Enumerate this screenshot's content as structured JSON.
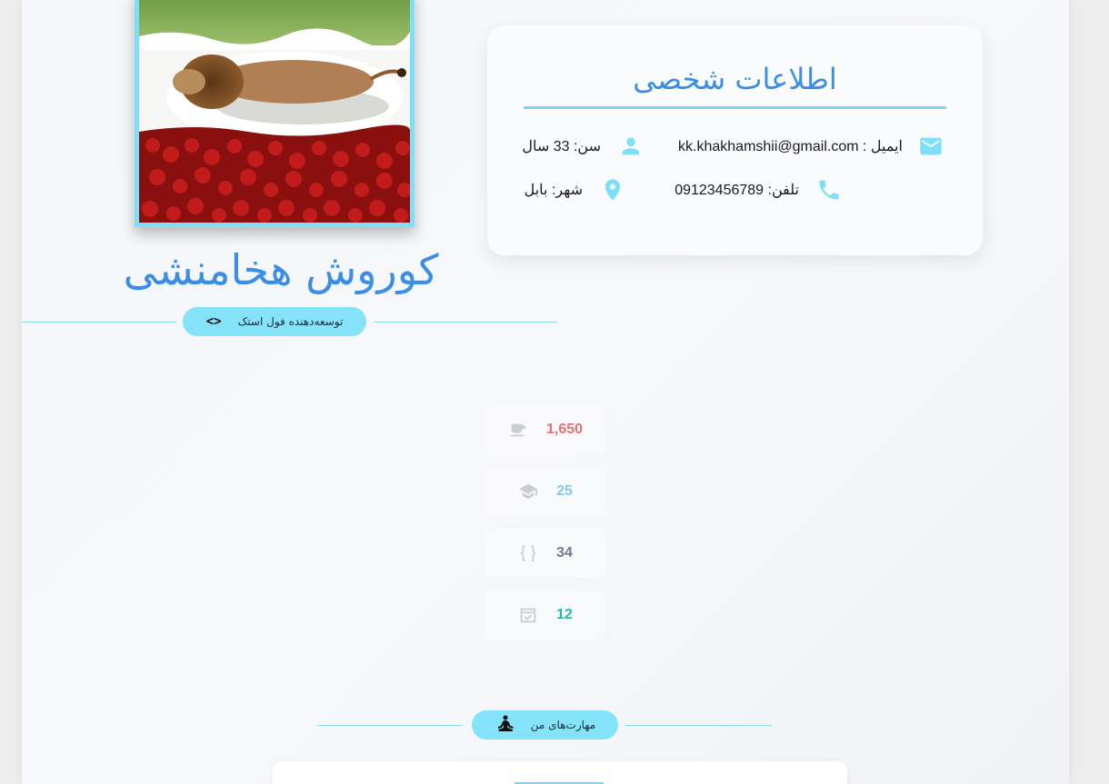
{
  "profile": {
    "name": "کوروش هخامنشی",
    "role": "توسعه‌دهنده فول استک",
    "role_icon": "code-icon"
  },
  "info_card": {
    "title": "اطلاعات شخصی",
    "items": [
      {
        "icon": "mail-icon",
        "text": "ایمیل : kk.khakhamshii@gmail.com"
      },
      {
        "icon": "person-icon",
        "text": "سن: 33 سال"
      },
      {
        "icon": "phone-icon",
        "text": "تلفن: 09123456789"
      },
      {
        "icon": "location-icon",
        "text": "شهر: بابل"
      }
    ]
  },
  "stats": [
    {
      "icon": "coffee-icon",
      "value": "1,650",
      "color": "#e57373"
    },
    {
      "icon": "graduation-cap-icon",
      "value": "25",
      "color": "#7fc8f0"
    },
    {
      "icon": "curly-braces-icon",
      "value": "34",
      "color": "#6b7a8c"
    },
    {
      "icon": "calendar-check-icon",
      "value": "12",
      "color": "#26b8a6"
    }
  ],
  "skills": {
    "label": "مهارت‌های من",
    "icon": "meditation-icon"
  },
  "colors": {
    "accent": "#3b8ee5",
    "pill": "#84e3f8",
    "icon": "#7de0f8"
  }
}
